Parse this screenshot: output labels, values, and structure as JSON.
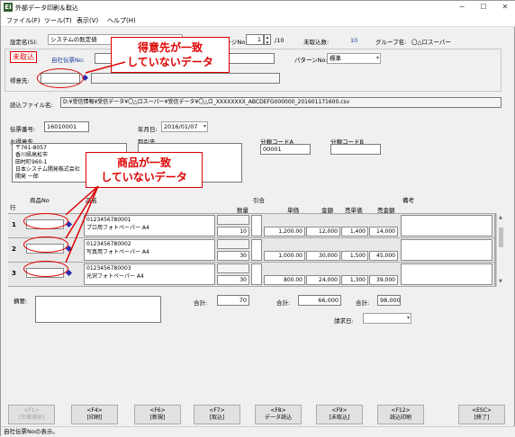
{
  "window": {
    "title": "外部データ印刷＆取込",
    "icon_text": "EI",
    "minimize": "─",
    "maximize": "☐",
    "close": "✕"
  },
  "menu": [
    "ファイル(F)",
    "ツール(T)",
    "表示(V)",
    "ヘルプ(H)"
  ],
  "settings": {
    "name_label": "設定名(S):",
    "name_value": "システムの既定値",
    "page_label": "ページNo:",
    "page_value": "1",
    "page_total": "/10",
    "unimported_label": "未取込数:",
    "unimported_value": "10",
    "group_label": "グループ名:",
    "group_value": "〇△ロスーパー"
  },
  "status_tag": "未取込",
  "header": {
    "own_slip_label": "自社伝票No:",
    "pattern_label": "パターンNo:",
    "pattern_value": "標準",
    "customer_label": "得意先:"
  },
  "file": {
    "label": "読込ファイル名:",
    "value": "D:¥受信情報¥受信データ¥〇△ロスーパー¥受信データ¥〇△ロ_XXXXXXXX_ABCDEFG000000_201601171600.csv"
  },
  "slip": {
    "number_label": "伝票番号:",
    "number_value": "16010001",
    "date_label": "年月日:",
    "date_value": "2016/01/07",
    "customer_label": "お得意先",
    "customer_lines": [
      "〒761-8057",
      "香川県高松市",
      "田村町960-1",
      "日本システム開発株式会社",
      "開発 一郎"
    ],
    "dest_label": "取引先",
    "class_a_label": "分類コードA",
    "class_a_value": "00001",
    "class_b_label": "分類コードB"
  },
  "grid": {
    "headers": {
      "row": "行",
      "item_no": "商品No",
      "item_name": "品名",
      "discount": "引合",
      "qty": "数量",
      "unit_price": "単価",
      "amount": "金額",
      "sell_price": "売単価",
      "sell_amount": "売金額",
      "note": "備考"
    },
    "rows": [
      {
        "num": "1",
        "code": "0123456780001",
        "name": "プロ用フォトペーパー A4",
        "qty": "10",
        "unit_price": "1,200.00",
        "amount": "12,000",
        "sell_price": "1,400",
        "sell_amount": "14,000"
      },
      {
        "num": "2",
        "code": "0123456780002",
        "name": "写真用フォトペーパー A4",
        "qty": "30",
        "unit_price": "1,000.00",
        "amount": "30,000",
        "sell_price": "1,500",
        "sell_amount": "45,000"
      },
      {
        "num": "3",
        "code": "0123456780003",
        "name": "光沢フォトペーパー A4",
        "qty": "30",
        "unit_price": "800.00",
        "amount": "24,000",
        "sell_price": "1,300",
        "sell_amount": "39,000"
      }
    ]
  },
  "totals": {
    "memo_label": "摘要:",
    "total_label1": "合計:",
    "qty_total": "70",
    "total_label2": "合計:",
    "amount_total": "66,000",
    "total_label3": "合計:",
    "sell_total": "98,000",
    "billing_label": "請求日:"
  },
  "callouts": {
    "customer": [
      "得意先が一致",
      "していないデータ"
    ],
    "item": [
      "商品が一致",
      "していないデータ"
    ]
  },
  "fkeys": [
    {
      "key": "<F1>",
      "label": "[仕様選択]",
      "disabled": true
    },
    {
      "key": "<F4>",
      "label": "[印刷]"
    },
    {
      "key": "<F6>",
      "label": "[新規]"
    },
    {
      "key": "<F7>",
      "label": "[取込]"
    },
    {
      "key": "<F8>",
      "label": "データ読込"
    },
    {
      "key": "<F9>",
      "label": "[未取込]"
    },
    {
      "key": "<F12>",
      "label": "読込印刷"
    },
    {
      "key": "<ESC>",
      "label": "[終了]"
    }
  ],
  "statusbar": "自社伝票Noの表示。",
  "colors": {
    "callout": "#dd0000",
    "diamond": "#2a2ab0"
  }
}
